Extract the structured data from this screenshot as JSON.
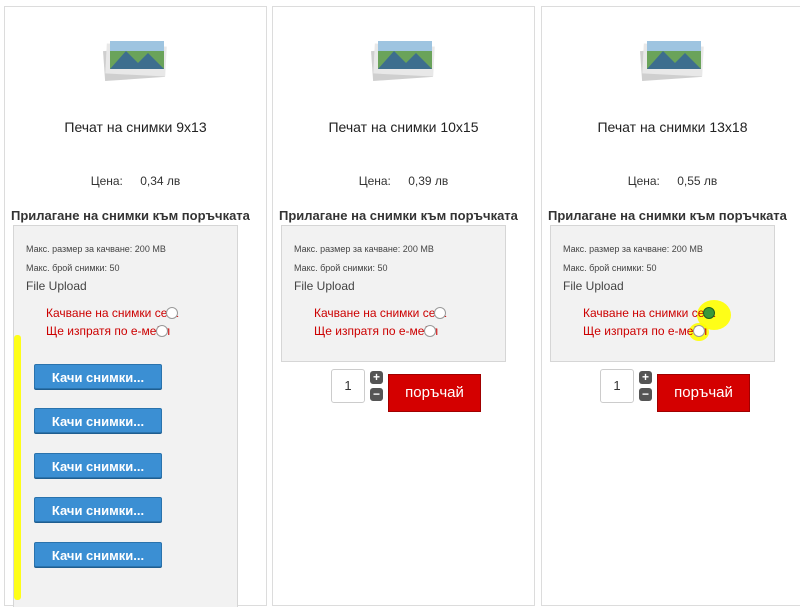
{
  "products": [
    {
      "title": "Печат на снимки 9x13",
      "price_label": "Цена:",
      "price": "0,34 лв"
    },
    {
      "title": "Печат на снимки 10x15",
      "price_label": "Цена:",
      "price": "0,39 лв"
    },
    {
      "title": "Печат на снимки 13x18",
      "price_label": "Цена:",
      "price": "0,55 лв"
    }
  ],
  "attach_heading": "Прилагане на снимки към поръчката",
  "upload": {
    "max_size": "Макс. размер за качване: 200 MB",
    "max_count": "Макс. брой снимки: 50",
    "file_upload": "File Upload",
    "option_upload_now": "Качване на снимки сега",
    "option_email": "Ще изпратя по е-мейл"
  },
  "upload_buttons": [
    "Качи снимки...",
    "Качи снимки...",
    "Качи снимки...",
    "Качи снимки...",
    "Качи снимки..."
  ],
  "quantity": "1",
  "plus": "+",
  "minus": "−",
  "order_label": "поръчай",
  "colors": {
    "accent_red": "#d40000",
    "upload_blue": "#3b8fd3",
    "highlight_yellow": "#ffff00"
  },
  "icons": [
    "photo-stack-icon",
    "radio-button",
    "plus-icon",
    "minus-icon"
  ]
}
